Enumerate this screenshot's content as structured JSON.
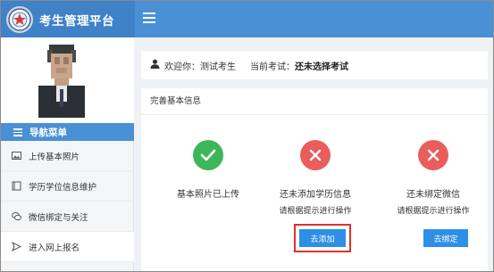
{
  "app": {
    "title": "考生管理平台"
  },
  "colors": {
    "primary": "#4a90d4",
    "success": "#3fb55a",
    "danger": "#e95d5d",
    "button": "#2d8fe6",
    "highlight": "#e03030"
  },
  "sidebar": {
    "nav_header": "导航菜单",
    "items": [
      {
        "label": "上传基本照片",
        "icon": "image-icon"
      },
      {
        "label": "学历学位信息维护",
        "icon": "book-icon"
      },
      {
        "label": "微信绑定与关注",
        "icon": "chat-bubbles-icon"
      },
      {
        "label": "进入网上报名",
        "icon": "send-icon"
      }
    ]
  },
  "welcome": {
    "greeting": "欢迎你：测试考生",
    "exam_label": "当前考试：",
    "exam_value": "还未选择考试"
  },
  "panel": {
    "title": "完善基本信息",
    "steps": [
      {
        "status": "done",
        "title": "基本照片已上传",
        "hint": "",
        "button": ""
      },
      {
        "status": "todo",
        "title": "还未添加学历信息",
        "hint": "请根据提示进行操作",
        "button": "去添加"
      },
      {
        "status": "todo",
        "title": "还未绑定微信",
        "hint": "请根据提示进行操作",
        "button": "去绑定"
      }
    ]
  }
}
